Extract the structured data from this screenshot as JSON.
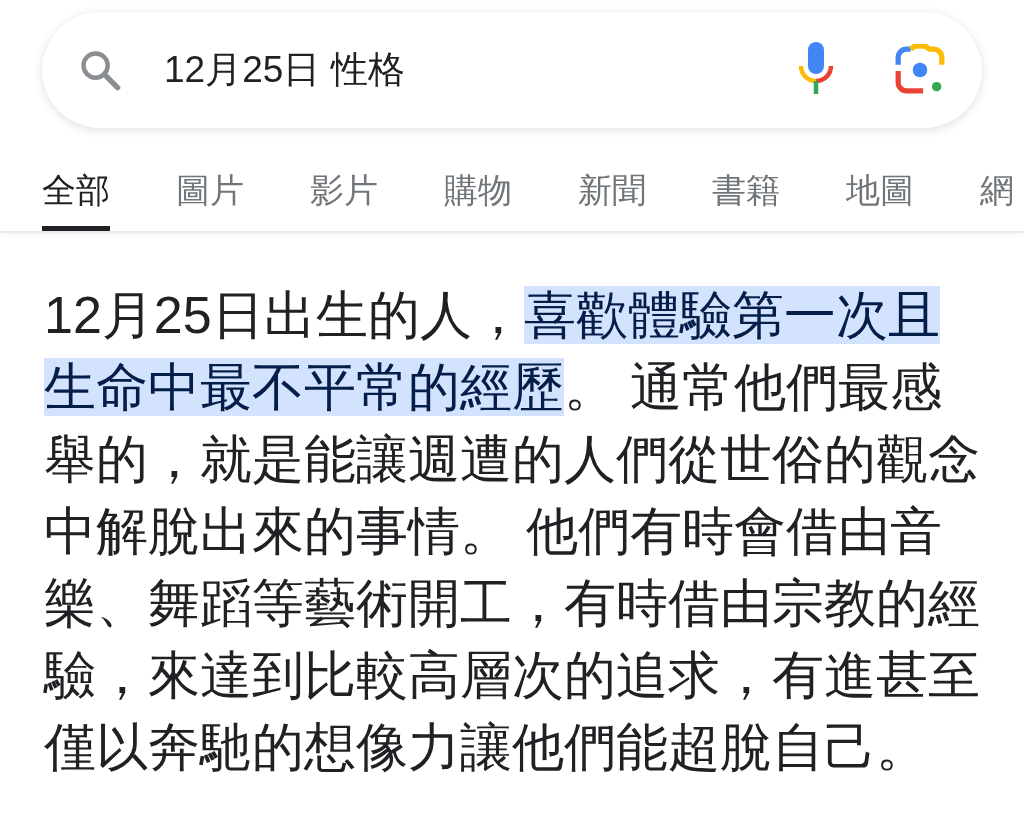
{
  "search": {
    "value": "12月25日 性格"
  },
  "tabs": [
    {
      "label": "全部",
      "selected": true
    },
    {
      "label": "圖片",
      "selected": false
    },
    {
      "label": "影片",
      "selected": false
    },
    {
      "label": "購物",
      "selected": false
    },
    {
      "label": "新聞",
      "selected": false
    },
    {
      "label": "書籍",
      "selected": false
    },
    {
      "label": "地圖",
      "selected": false
    },
    {
      "label": "網",
      "selected": false
    }
  ],
  "snippet": [
    {
      "text": "12月25日出生的人，",
      "highlighted": false
    },
    {
      "text": "喜歡體驗第一次且生命中最不平常的經歷",
      "highlighted": true
    },
    {
      "text": "。 通常他們最感舉的，就是能讓週遭的人們從世俗的觀念中解脫出來的事情。 他們有時會借由音樂、舞蹈等藝術開工，有時借由宗教的經驗，來達到比較高層次的追求，有進甚至僅以奔馳的想像力讓他們能超脫自己。",
      "highlighted": false
    }
  ]
}
